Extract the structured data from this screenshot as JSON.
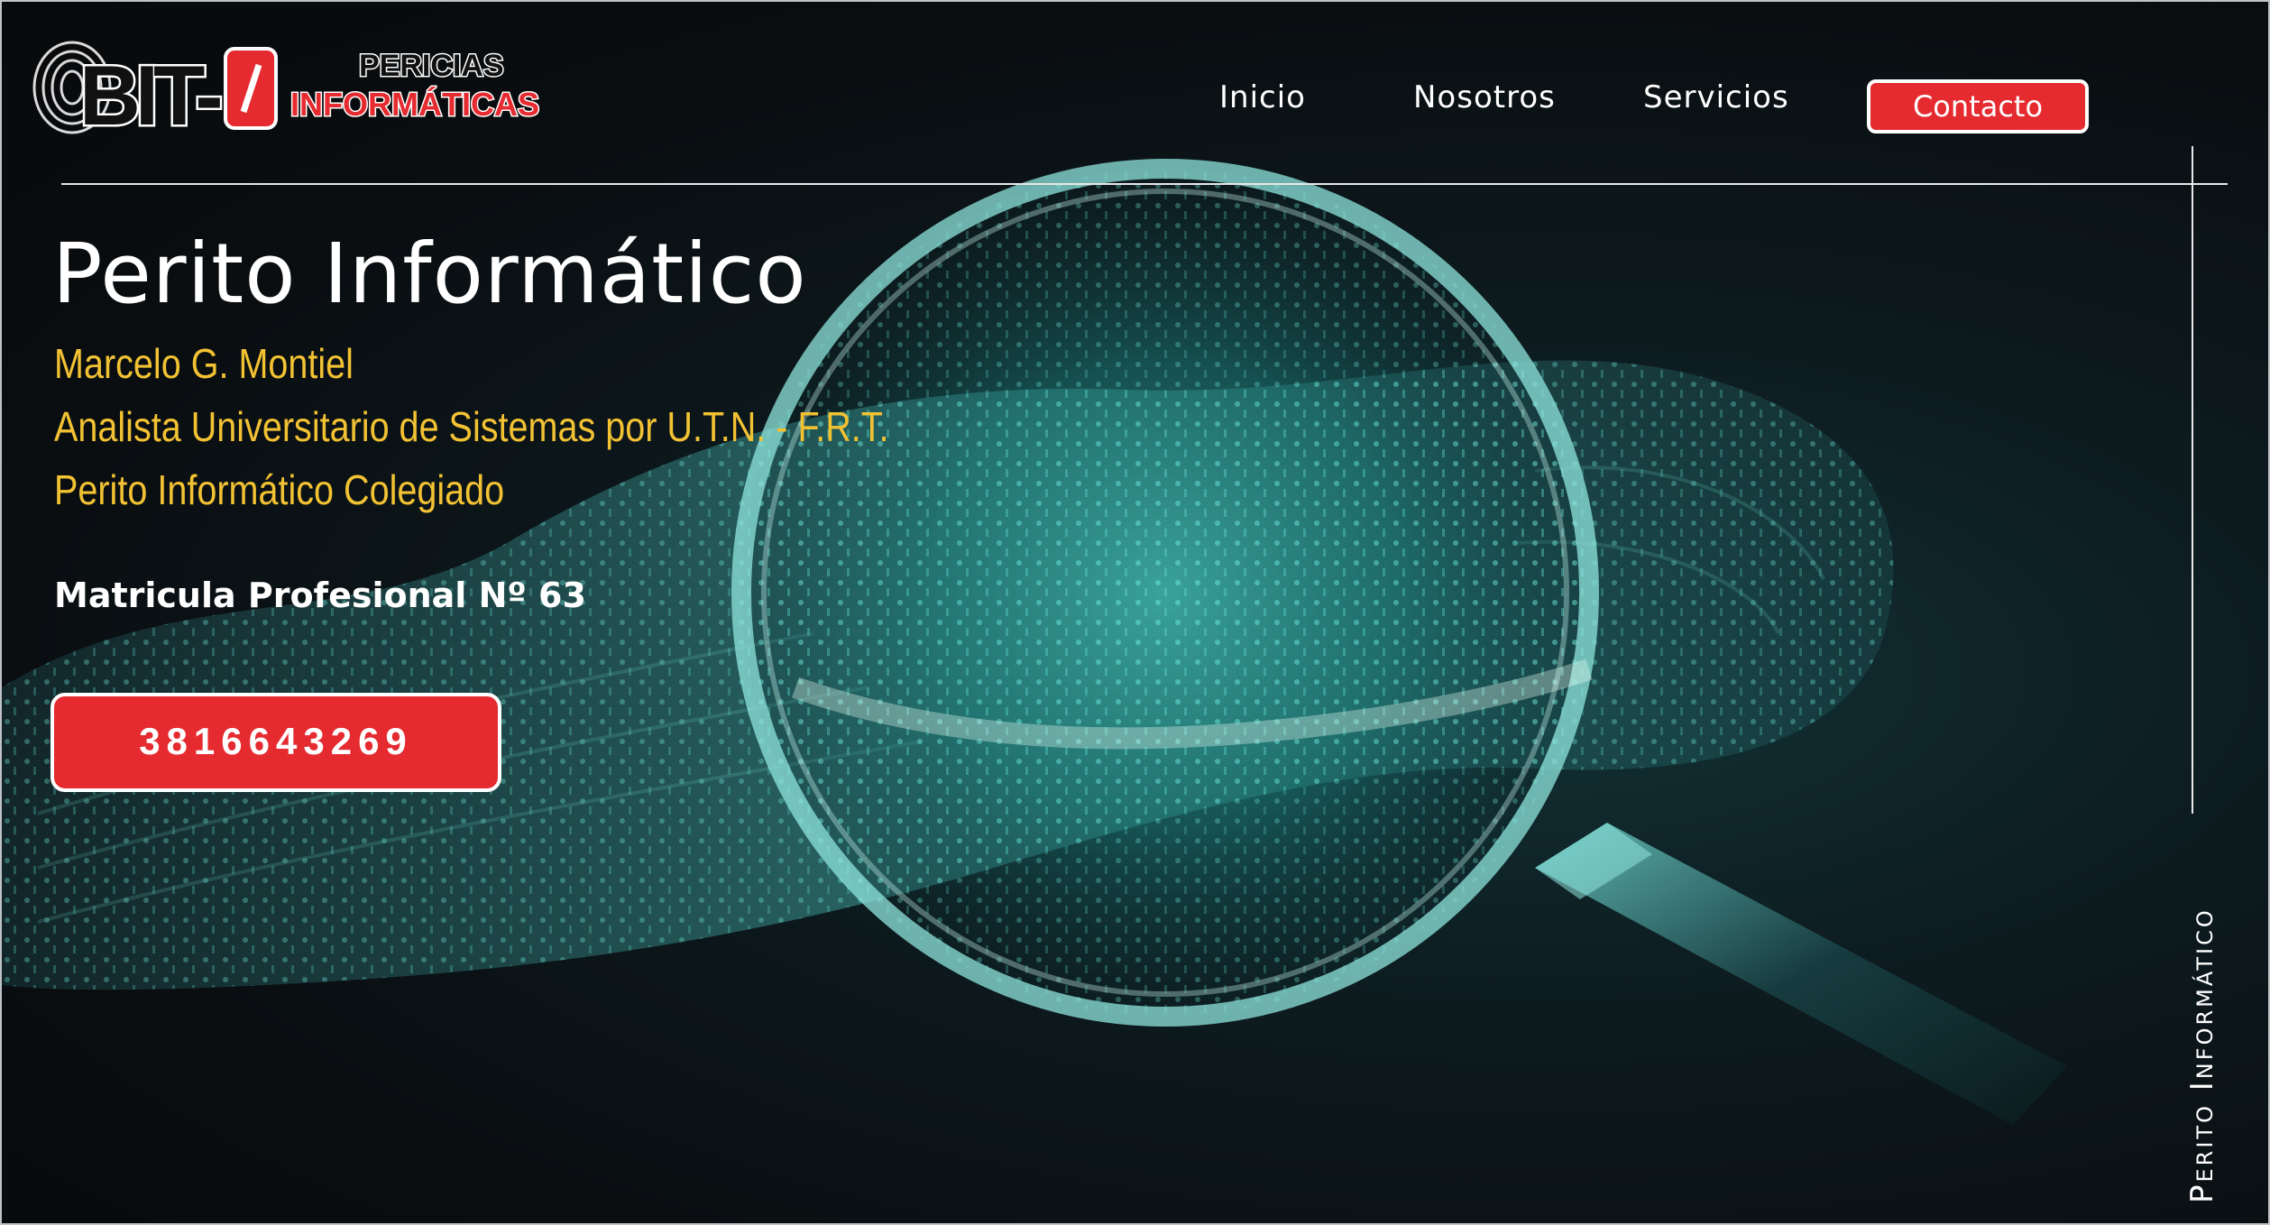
{
  "brand": {
    "logo_mark": "BIT-0",
    "logo_line1": "PERICIAS",
    "logo_line2": "INFORMÁTICAS"
  },
  "nav": {
    "items": [
      {
        "label": "Inicio"
      },
      {
        "label": "Nosotros"
      },
      {
        "label": "Servicios"
      }
    ],
    "cta_label": "Contacto"
  },
  "hero": {
    "title": "Perito Informático",
    "lines": [
      "Marcelo G. Montiel",
      "Analista Universitario de Sistemas por U.T.N. - F.R.T.",
      "Perito Informático Colegiado"
    ],
    "matricula": "Matricula Profesional Nº 63",
    "phone": "3816643269"
  },
  "side_label": "Perito Informático",
  "colors": {
    "accent_red": "#e52b30",
    "accent_yellow": "#f2c233",
    "background": "#0b0f12",
    "teal": "#3fd6c8"
  }
}
